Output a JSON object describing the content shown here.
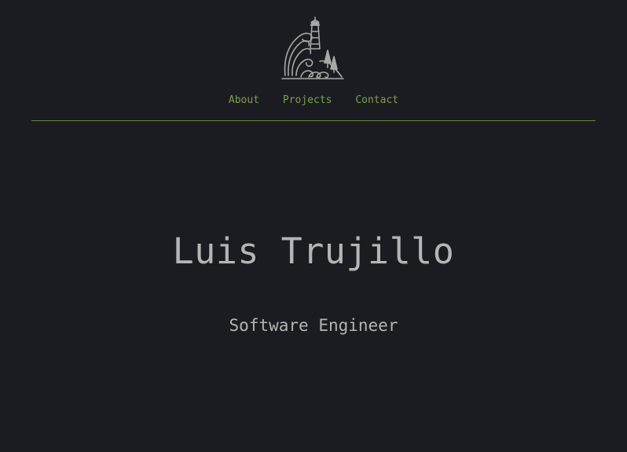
{
  "brand": {
    "logo_icon": "lighthouse-waves-icon"
  },
  "nav": {
    "items": [
      {
        "label": "About"
      },
      {
        "label": "Projects"
      },
      {
        "label": "Contact"
      }
    ]
  },
  "hero": {
    "name": "Luis Trujillo",
    "title": "Software Engineer"
  },
  "colors": {
    "background": "#1b1c21",
    "accent": "#7aa04f",
    "text": "#b5b5b5"
  }
}
